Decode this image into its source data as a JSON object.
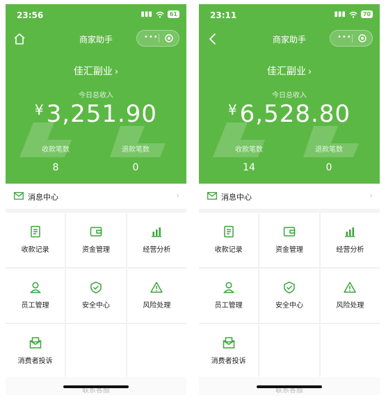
{
  "brand_color": "#5cb845",
  "screens": [
    {
      "status": {
        "time": "23:56",
        "battery": "61"
      },
      "nav": {
        "title": "商家助手",
        "left_icon": "home-icon"
      },
      "merchant": "佳汇副业",
      "income": {
        "label": "今日总收入",
        "currency": "¥",
        "amount": "3,251.90"
      },
      "stats": [
        {
          "label": "收款笔数",
          "value": "8"
        },
        {
          "label": "退款笔数",
          "value": "0"
        }
      ],
      "message_center": "消息中心",
      "menu": [
        {
          "label": "收款记录",
          "icon": "receipt-icon"
        },
        {
          "label": "资金管理",
          "icon": "wallet-icon"
        },
        {
          "label": "经营分析",
          "icon": "bar-chart-icon"
        },
        {
          "label": "员工管理",
          "icon": "person-icon"
        },
        {
          "label": "安全中心",
          "icon": "shield-icon"
        },
        {
          "label": "风险处理",
          "icon": "warning-icon"
        },
        {
          "label": "消费者投诉",
          "icon": "complaint-icon"
        }
      ],
      "contact": "联系客服"
    },
    {
      "status": {
        "time": "23:11",
        "battery": "70"
      },
      "nav": {
        "title": "商家助手",
        "left_icon": "back-icon"
      },
      "merchant": "佳汇副业",
      "income": {
        "label": "今日总收入",
        "currency": "¥",
        "amount": "6,528.80"
      },
      "stats": [
        {
          "label": "收款笔数",
          "value": "14"
        },
        {
          "label": "退款笔数",
          "value": "0"
        }
      ],
      "message_center": "消息中心",
      "menu": [
        {
          "label": "收款记录",
          "icon": "receipt-icon"
        },
        {
          "label": "资金管理",
          "icon": "wallet-icon"
        },
        {
          "label": "经营分析",
          "icon": "bar-chart-icon"
        },
        {
          "label": "员工管理",
          "icon": "person-icon"
        },
        {
          "label": "安全中心",
          "icon": "shield-icon"
        },
        {
          "label": "风险处理",
          "icon": "warning-icon"
        },
        {
          "label": "消费者投诉",
          "icon": "complaint-icon"
        }
      ],
      "contact": "联系客服"
    }
  ]
}
